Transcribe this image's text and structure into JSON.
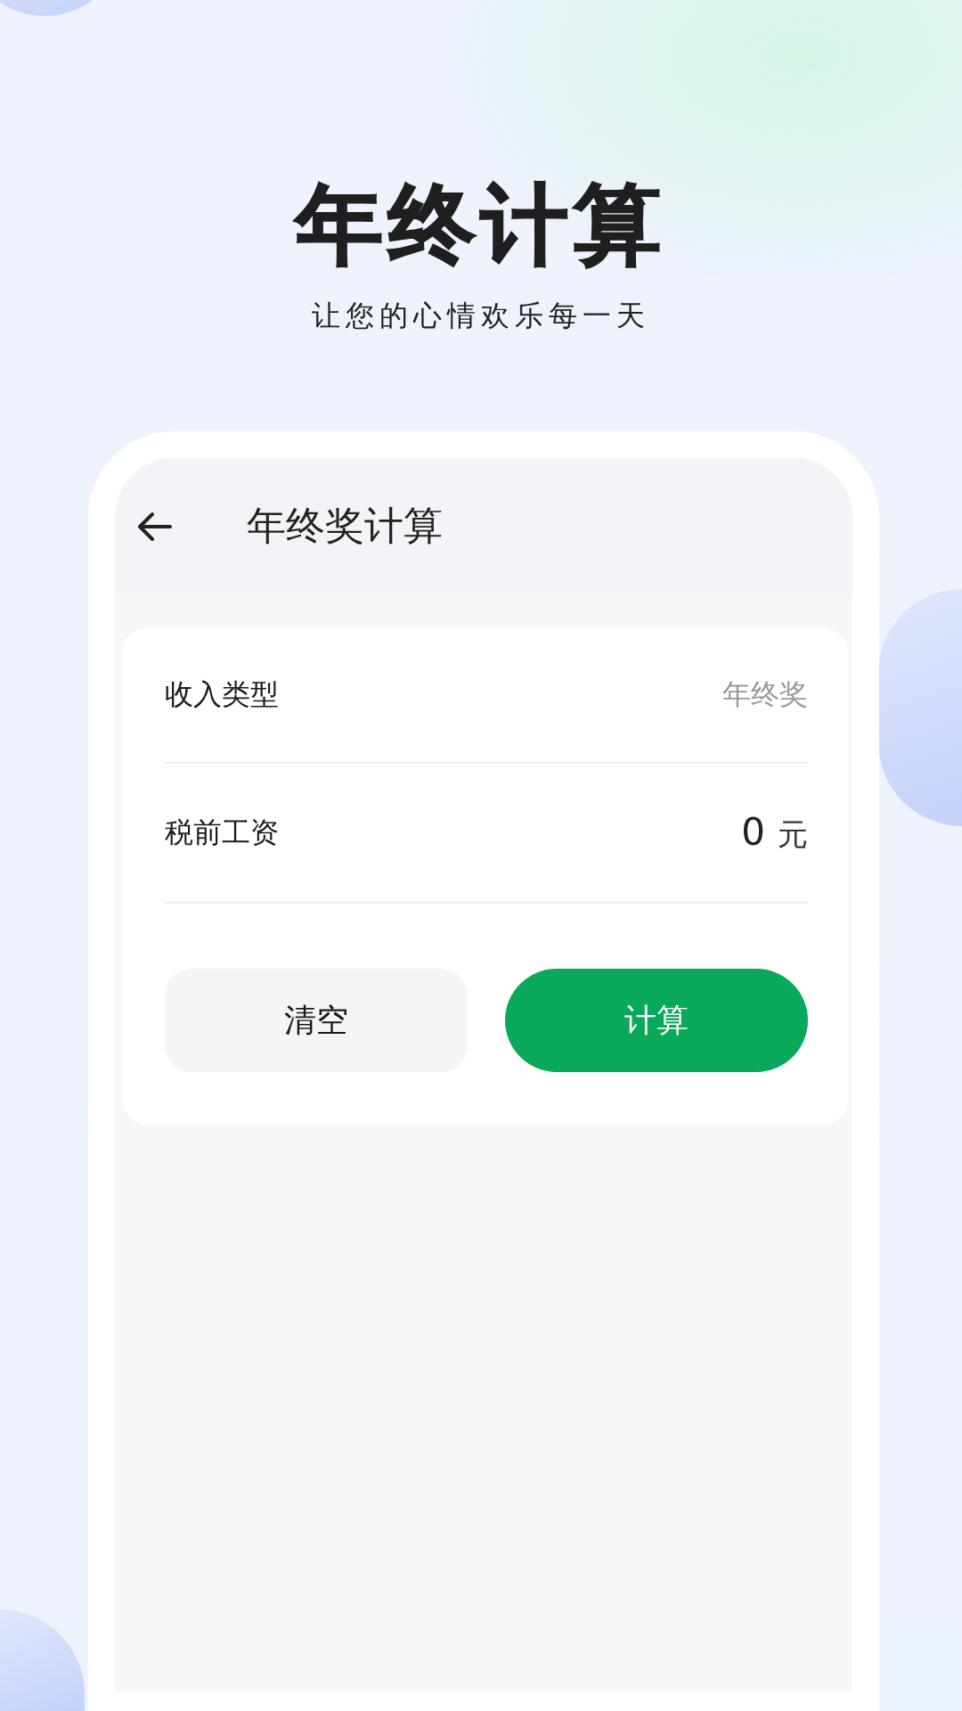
{
  "promo": {
    "title": "年终计算",
    "subtitle": "让您的心情欢乐每一天"
  },
  "screen": {
    "title": "年终奖计算",
    "rows": [
      {
        "kind": "select",
        "label": "收入类型",
        "value": "年终奖"
      },
      {
        "kind": "input",
        "label": "税前工资",
        "value": "0",
        "unit": "元"
      }
    ],
    "buttons": [
      {
        "kind": "secondary",
        "label": "清空"
      },
      {
        "kind": "primary",
        "label": "计算"
      }
    ]
  }
}
